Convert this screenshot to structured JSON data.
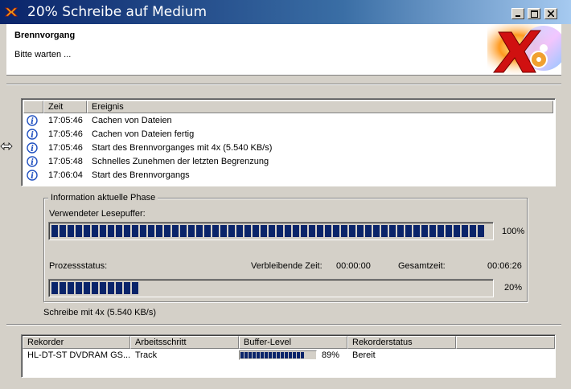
{
  "window": {
    "title": "20% Schreibe auf Medium",
    "header_title": "Brennvorgang",
    "header_subtitle": "Bitte warten ..."
  },
  "colors": {
    "title_start": "#0a246a",
    "title_end": "#a6caf0",
    "progress": "#0a246a"
  },
  "events": {
    "columns": {
      "time": "Zeit",
      "event": "Ereignis"
    },
    "rows": [
      {
        "icon": "info-icon",
        "time": "17:05:46",
        "event": "Cachen von Dateien"
      },
      {
        "icon": "info-icon",
        "time": "17:05:46",
        "event": "Cachen von Dateien fertig"
      },
      {
        "icon": "info-icon",
        "time": "17:05:46",
        "event": "Start des Brennvorganges mit 4x (5.540 KB/s)"
      },
      {
        "icon": "info-icon",
        "time": "17:05:48",
        "event": "Schnelles Zunehmen der letzten Begrenzung"
      },
      {
        "icon": "info-icon",
        "time": "17:06:04",
        "event": "Start des Brennvorgangs"
      }
    ]
  },
  "phase": {
    "group_title": "Information aktuelle Phase",
    "buffer_label": "Verwendeter Lesepuffer:",
    "buffer_percent_text": "100%",
    "buffer_fraction": 1.0,
    "process_label": "Prozessstatus:",
    "remaining_label": "Verbleibende Zeit:",
    "remaining_value": "00:00:00",
    "total_label": "Gesamtzeit:",
    "total_value": "00:06:26",
    "process_percent_text": "20%",
    "process_fraction": 0.2
  },
  "status_text": "Schreibe mit 4x (5.540 KB/s)",
  "recorders": {
    "columns": {
      "recorder": "Rekorder",
      "step": "Arbeitsschritt",
      "buffer": "Buffer-Level",
      "status": "Rekorderstatus"
    },
    "rows": [
      {
        "recorder": "HL-DT-ST DVDRAM GS...",
        "step": "Track",
        "buffer_text": "89%",
        "buffer_fraction": 0.89,
        "status": "Bereit"
      }
    ]
  }
}
